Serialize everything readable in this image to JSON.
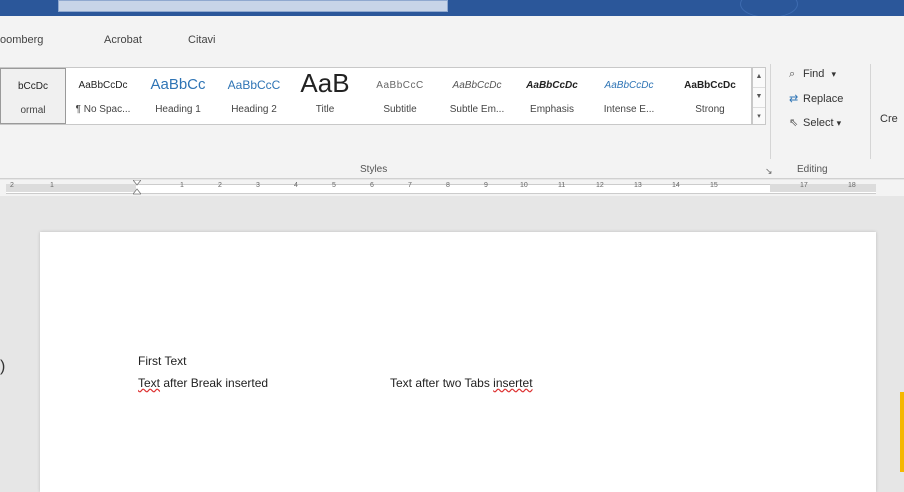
{
  "tabs": [
    {
      "label": "oomberg"
    },
    {
      "label": "Acrobat"
    },
    {
      "label": "Citavi"
    }
  ],
  "styles": [
    {
      "preview": "bCcDc",
      "name": "ormal",
      "selected": true
    },
    {
      "preview": "AaBbCcDc",
      "name": "¶ No Spac..."
    },
    {
      "preview": "AaBbCc",
      "name": "Heading 1"
    },
    {
      "preview": "AaBbCcC",
      "name": "Heading 2"
    },
    {
      "preview": "AaB",
      "name": "Title"
    },
    {
      "preview": "AaBbCcC",
      "name": "Subtitle"
    },
    {
      "preview": "AaBbCcDc",
      "name": "Subtle Em..."
    },
    {
      "preview": "AaBbCcDc",
      "name": "Emphasis"
    },
    {
      "preview": "AaBbCcDc",
      "name": "Intense E..."
    },
    {
      "preview": "AaBbCcDc",
      "name": "Strong"
    }
  ],
  "groups": {
    "styles": "Styles",
    "editing": "Editing"
  },
  "editing": {
    "find": "Find",
    "find_arrow": "▾",
    "replace": "Replace",
    "select": "Select",
    "select_arrow": "▾"
  },
  "create_partial": "Cre",
  "ruler": {
    "numbers": [
      "2",
      "1",
      "1",
      "2",
      "3",
      "4",
      "5",
      "6",
      "7",
      "8",
      "9",
      "10",
      "11",
      "12",
      "13",
      "14",
      "15",
      "17",
      "18"
    ]
  },
  "document": {
    "line1": "First Text",
    "line2_squiggled": "Text",
    "line2_rest": " after Break inserted",
    "tab_text_a": "Text after two Tabs ",
    "tab_text_squiggled": "insertet"
  },
  "left_paren": ")"
}
